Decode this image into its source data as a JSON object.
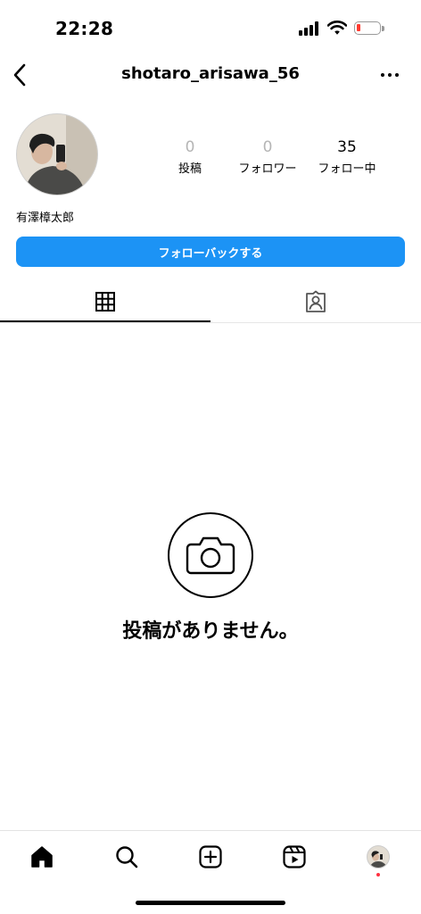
{
  "status_bar": {
    "time": "22:28",
    "icons": [
      "cellular-signal-icon",
      "wifi-icon",
      "battery-low-icon"
    ]
  },
  "header": {
    "username": "shotaro_arisawa_56",
    "back_icon": "chevron-left-icon",
    "more_icon": "ellipsis-icon"
  },
  "profile": {
    "full_name": "有澤樟太郎",
    "stats": [
      {
        "value": "0",
        "label": "投稿"
      },
      {
        "value": "0",
        "label": "フォロワー"
      },
      {
        "value": "35",
        "label": "フォロー中"
      }
    ],
    "follow_back_label": "フォローバックする"
  },
  "tabs": [
    {
      "icon": "grid-icon",
      "active": true
    },
    {
      "icon": "tagged-person-icon",
      "active": false
    }
  ],
  "empty_state": {
    "icon": "camera-icon",
    "text": "投稿がありません。"
  },
  "bottom_nav": [
    {
      "icon": "home-icon",
      "active": true
    },
    {
      "icon": "search-icon"
    },
    {
      "icon": "add-post-icon"
    },
    {
      "icon": "reels-icon"
    },
    {
      "icon": "profile-avatar-icon",
      "has_notification_dot": true
    }
  ],
  "colors": {
    "accent": "#1c93f5",
    "muted_text": "#b5b5b5",
    "notification_dot": "#ff3040",
    "battery_low": "#ff3b30"
  }
}
